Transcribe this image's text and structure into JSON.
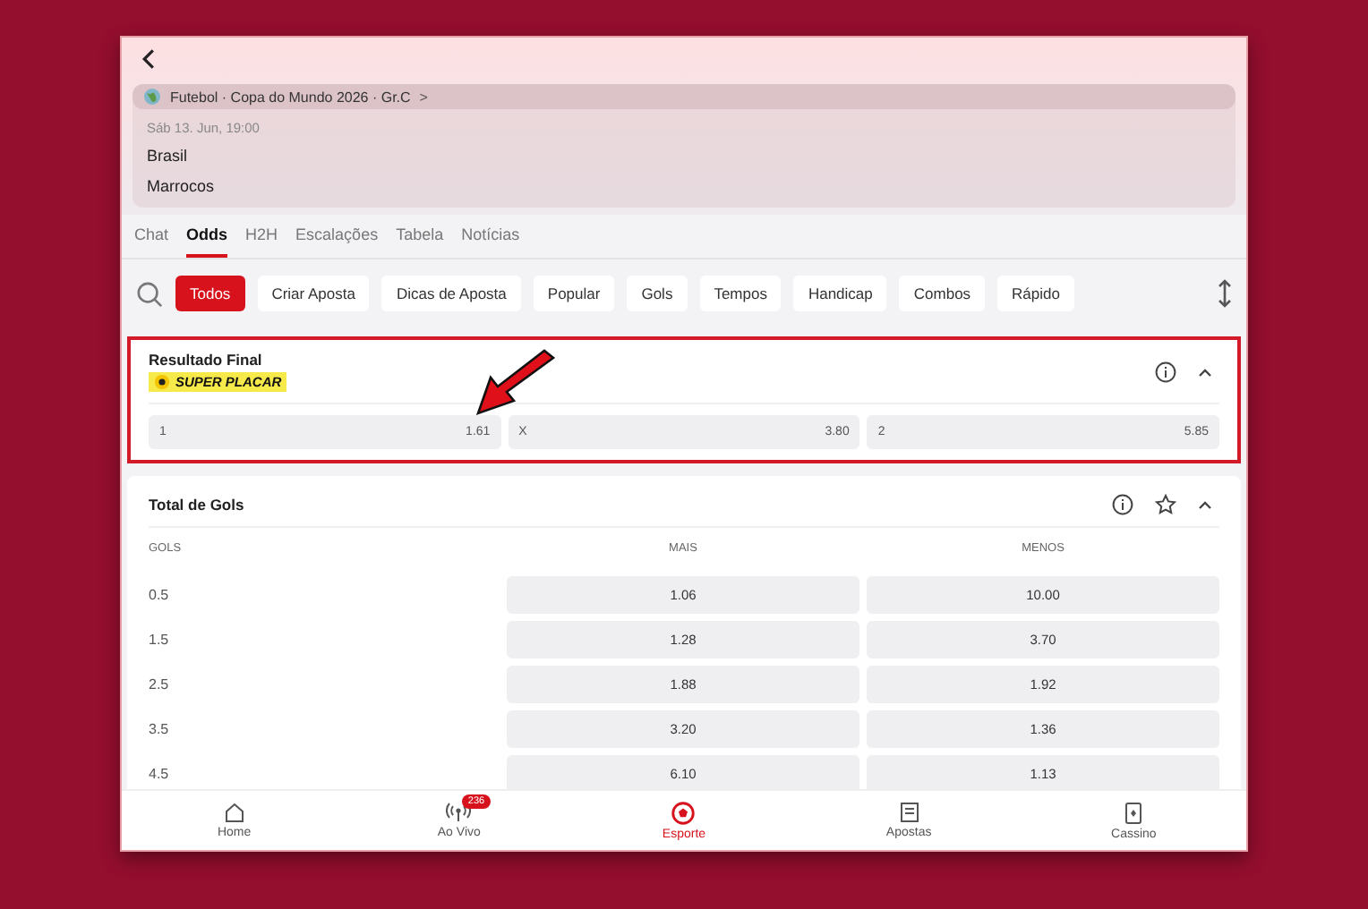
{
  "match": {
    "competition": "Futebol · Copa do Mundo 2026 · Gr.C",
    "competition_chevron": ">",
    "datetime": "Sáb 13. Jun, 19:00",
    "teams": [
      "Brasil",
      "Marrocos"
    ]
  },
  "tabs": [
    {
      "label": "Chat",
      "selected": false
    },
    {
      "label": "Odds",
      "selected": true
    },
    {
      "label": "H2H",
      "selected": false
    },
    {
      "label": "Escalações",
      "selected": false
    },
    {
      "label": "Tabela",
      "selected": false
    },
    {
      "label": "Notícias",
      "selected": false
    }
  ],
  "filters": [
    {
      "label": "Todos",
      "selected": true
    },
    {
      "label": "Criar Aposta",
      "selected": false
    },
    {
      "label": "Dicas de Aposta",
      "selected": false
    },
    {
      "label": "Popular",
      "selected": false
    },
    {
      "label": "Gols",
      "selected": false
    },
    {
      "label": "Tempos",
      "selected": false
    },
    {
      "label": "Handicap",
      "selected": false
    },
    {
      "label": "Combos",
      "selected": false
    },
    {
      "label": "Rápido",
      "selected": false
    }
  ],
  "result_market": {
    "title": "Resultado Final",
    "badge": "SUPER PLACAR",
    "highlighted": true,
    "outcomes": [
      {
        "label": "1",
        "odd": "1.61"
      },
      {
        "label": "X",
        "odd": "3.80"
      },
      {
        "label": "2",
        "odd": "5.85"
      }
    ]
  },
  "goals_market": {
    "title": "Total de Gols",
    "columns": [
      "GOLS",
      "MAIS",
      "MENOS"
    ],
    "rows": [
      {
        "line": "0.5",
        "over": "1.06",
        "under": "10.00"
      },
      {
        "line": "1.5",
        "over": "1.28",
        "under": "3.70"
      },
      {
        "line": "2.5",
        "over": "1.88",
        "under": "1.92"
      },
      {
        "line": "3.5",
        "over": "3.20",
        "under": "1.36"
      },
      {
        "line": "4.5",
        "over": "6.10",
        "under": "1.13"
      }
    ]
  },
  "bottom_nav": [
    {
      "label": "Home",
      "kind": "home",
      "selected": false
    },
    {
      "label": "Ao Vivo",
      "kind": "live",
      "badge": "236",
      "selected": false
    },
    {
      "label": "Esporte",
      "kind": "sport",
      "selected": true
    },
    {
      "label": "Apostas",
      "kind": "bets",
      "selected": false
    },
    {
      "label": "Cassino",
      "kind": "casino",
      "selected": false
    }
  ]
}
